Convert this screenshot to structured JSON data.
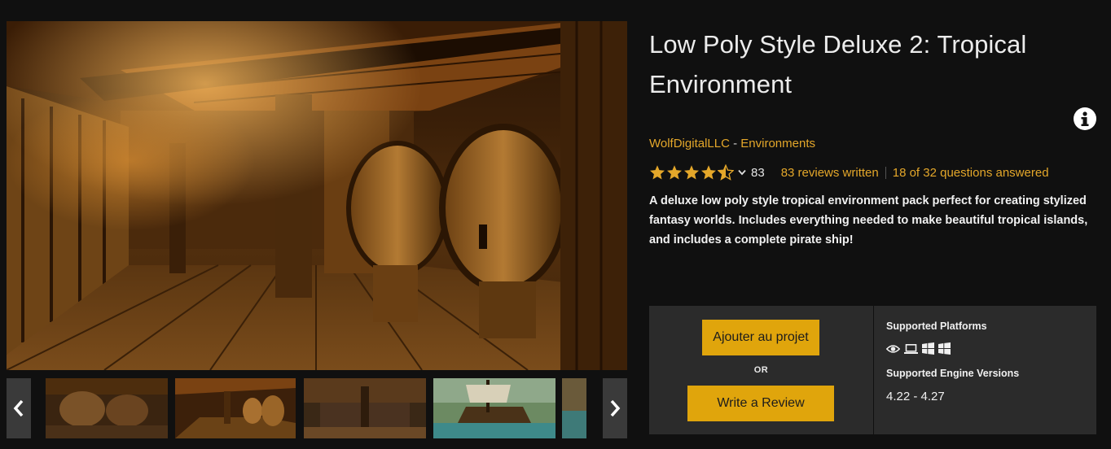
{
  "product": {
    "title": "Low Poly Style Deluxe 2: Tropical Environment",
    "seller": "WolfDigitalLLC",
    "byline_separator": " - ",
    "category": "Environments",
    "rating_stars": 4.5,
    "rating_count": "83",
    "reviews_link": "83 reviews written",
    "questions_link": "18 of 32 questions answered",
    "description": "A deluxe low poly style tropical environment pack perfect for creating stylized fantasy worlds. Includes everything needed to make beautiful tropical islands, and includes a complete pirate ship!"
  },
  "actions": {
    "add_to_project": "Ajouter au projet",
    "or": "OR",
    "write_review": "Write a Review"
  },
  "support": {
    "platforms_heading": "Supported Platforms",
    "platform_icons": [
      "eye-icon",
      "laptop-icon",
      "windows-icon",
      "windows-icon"
    ],
    "engine_heading": "Supported Engine Versions",
    "engine_versions": "4.22 - 4.27"
  },
  "gallery": {
    "thumbnails": [
      "barrels-interior",
      "ship-hold-barrels",
      "ship-deck-interior",
      "pirate-ship-exterior",
      "partial-thumbnail"
    ],
    "selected_index": 1
  },
  "colors": {
    "accent": "#e4a72a",
    "button": "#e0a50c",
    "background": "#101010",
    "panel": "#2b2b2b"
  }
}
